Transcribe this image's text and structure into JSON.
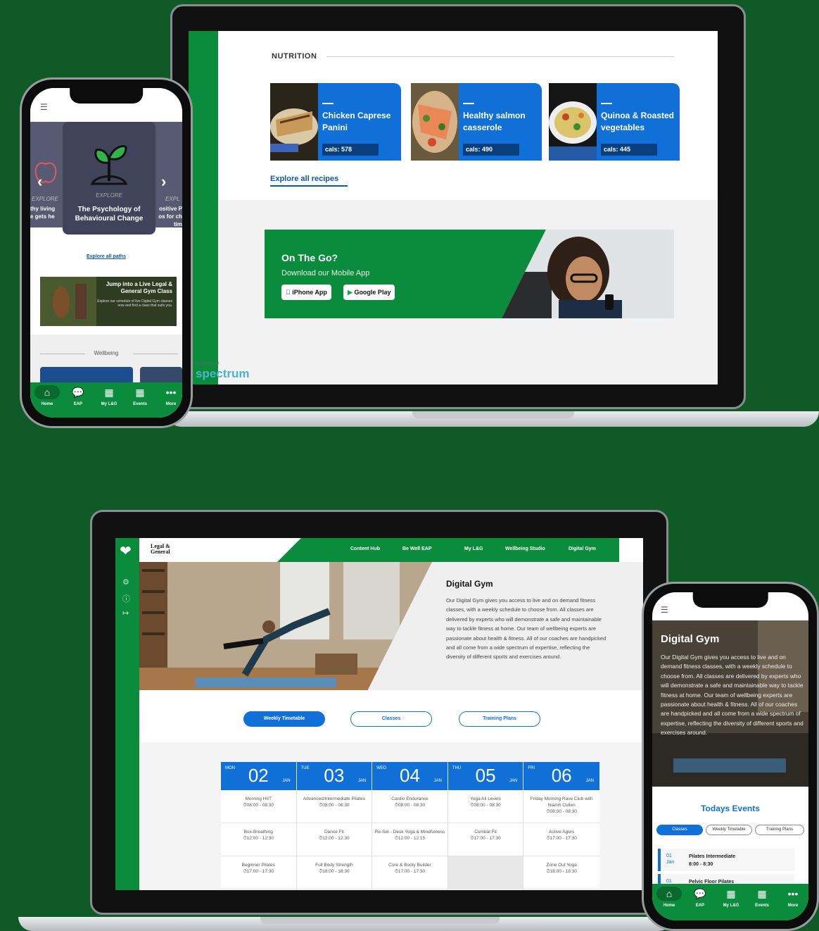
{
  "laptop_nutrition": {
    "section_heading": "NUTRITION",
    "recipes": [
      {
        "title": "Chicken Caprese Panini",
        "cals": "cals: 578"
      },
      {
        "title": "Healthy salmon casserole",
        "cals": "cals: 490"
      },
      {
        "title": "Quinoa & Roasted vegetables",
        "cals": "cals: 445"
      }
    ],
    "explore_link": "Explore all recipes",
    "promo": {
      "title": "On The Go?",
      "subtitle": "Download our Mobile App",
      "iphone_btn": "iPhone App",
      "google_btn": "Google Play"
    },
    "powered_by": "powered by:",
    "brand": "spectrum"
  },
  "phone_paths": {
    "carousel": {
      "left_label": "EXPLORE",
      "left_text": "thy living\ne gets he",
      "center_label": "EXPLORE",
      "center_title": "The Psychology of Behavioural Change",
      "right_label": "EXPL",
      "right_text": "ositive P\nos for ch\ntim"
    },
    "explore_link": "Explore all paths",
    "banner_title": "Jump into a Live Legal & General Gym Class",
    "banner_text": "Explore our schedule of live Digital Gym classes now and find a class that suits you.",
    "section_title": "Wellbeing",
    "nav": [
      {
        "label": "Home",
        "icon": "home-icon"
      },
      {
        "label": "EAP",
        "icon": "chat-icon"
      },
      {
        "label": "My L&G",
        "icon": "building-icon"
      },
      {
        "label": "Events",
        "icon": "calendar-icon"
      },
      {
        "label": "More",
        "icon": "more-icon"
      }
    ]
  },
  "laptop_gym": {
    "logo": "Legal & General",
    "nav": [
      "Content Hub",
      "Be Well EAP",
      "My L&G",
      "Wellbeing Studio",
      "Digital Gym"
    ],
    "title": "Digital Gym",
    "description": "Our Digital Gym gives you access to live and on demand fitness classes, with a weekly schedule to choose from. All classes are delivered by experts who will demonstrate a safe and maintainable way to tackle fitness at home. Our team of wellbeing experts are passionate about health & fitness. All of our coaches are handpicked and all come from a wide spectrum of expertise, reflecting the diversity of different sports and exercises around.",
    "tabs": [
      "Weekly Timetable",
      "Classes",
      "Training Plans"
    ],
    "timetable": [
      {
        "dow": "MON",
        "day": "02",
        "month": "JAN",
        "classes": [
          {
            "name": "Morning HIIT",
            "time": "⏱08:00 - 08:30"
          },
          {
            "name": "Box-Breathing",
            "time": "⏱12:00 - 12:30"
          },
          {
            "name": "Beginner Pilates",
            "time": "⏱17:00 - 17:30"
          }
        ]
      },
      {
        "dow": "TUE",
        "day": "03",
        "month": "JAN",
        "classes": [
          {
            "name": "Advanced/Intermediate Pilates",
            "time": "⏱08:00 - 08:30"
          },
          {
            "name": "Dance Fit",
            "time": "⏱12:00 - 12:30"
          },
          {
            "name": "Full Body Strength",
            "time": "⏱18:00 - 18:30"
          }
        ]
      },
      {
        "dow": "WED",
        "day": "04",
        "month": "JAN",
        "classes": [
          {
            "name": "Cardio Endurance",
            "time": "⏱08:00 - 08:30"
          },
          {
            "name": "Re-Set - Desk Yoga & Mindfulness",
            "time": "⏱12:00 - 12:15"
          },
          {
            "name": "Core & Booty Builder",
            "time": "⏱17:00 - 17:30"
          }
        ]
      },
      {
        "dow": "THU",
        "day": "05",
        "month": "JAN",
        "classes": [
          {
            "name": "Yoga All Levels",
            "time": "⏱08:00 - 08:30"
          },
          {
            "name": "Combat Fit",
            "time": "⏱17:00 - 17:30"
          },
          {
            "name": "",
            "time": ""
          }
        ]
      },
      {
        "dow": "FRI",
        "day": "06",
        "month": "JAN",
        "classes": [
          {
            "name": "Friday Morning Rave Club with Niamh Cullen",
            "time": "⏱08:00 - 08:30"
          },
          {
            "name": "Active Agers",
            "time": "⏱17:00 - 17:30"
          },
          {
            "name": "Zone Out Yoga",
            "time": "⏱18:00 - 18:30"
          }
        ]
      }
    ]
  },
  "phone_gym": {
    "title": "Digital Gym",
    "description": "Our Digital Gym gives you access to live and on demand fitness classes, with a weekly schedule to choose from. All classes are delivered by experts who will demonstrate a safe and maintainable way to tackle fitness at home. Our team of wellbeing experts are passionate about health & fitness. All of our coaches are handpicked and all come from a wide spectrum of expertise, reflecting the diversity of different sports and exercises around.",
    "events_title": "Todays Events",
    "tabs": [
      "Classes",
      "Weekly Timetable",
      "Training Plans"
    ],
    "events": [
      {
        "date": "01\nJan",
        "title": "Pilates Intermediate\n8:00 - 8:30"
      },
      {
        "date": "01",
        "title": "Pelvic Floor Pilates"
      }
    ]
  },
  "colors": {
    "background": "#0f5a27",
    "brand_green": "#0b8c3c",
    "brand_blue": "#1170d8"
  }
}
